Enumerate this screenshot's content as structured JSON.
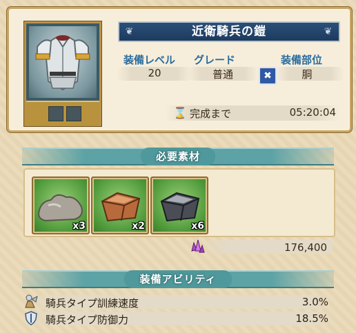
{
  "equipment": {
    "name": "近衛騎兵の鎧",
    "level_label": "装備レベル",
    "level_value": "20",
    "grade_label": "グレード",
    "grade_value": "普通",
    "part_label": "装備部位",
    "part_value": "胴",
    "part_icon": "armor-part-icon",
    "timer_label": "完成まで",
    "timer_value": "05:20:04"
  },
  "materials": {
    "header": "必要素材",
    "items": [
      {
        "icon": "stone-material-icon",
        "count": "x3"
      },
      {
        "icon": "copper-ingot-icon",
        "count": "x2"
      },
      {
        "icon": "iron-ingot-icon",
        "count": "x6"
      }
    ],
    "cost_icon": "purple-crystal-icon",
    "cost_value": "176,400"
  },
  "abilities": {
    "header": "装備アビリティ",
    "items": [
      {
        "icon": "cavalry-icon",
        "name": "騎兵タイプ訓練速度",
        "value": "3.0%"
      },
      {
        "icon": "shield-icon",
        "name": "騎兵タイプ防御力",
        "value": "18.5%"
      }
    ]
  },
  "colors": {
    "banner": "#1d3a5e",
    "label_blue": "#2a6c9e",
    "section_teal": "#5da3a6",
    "frame_gold": "#c8a565",
    "parchment": "#ead9b6"
  }
}
